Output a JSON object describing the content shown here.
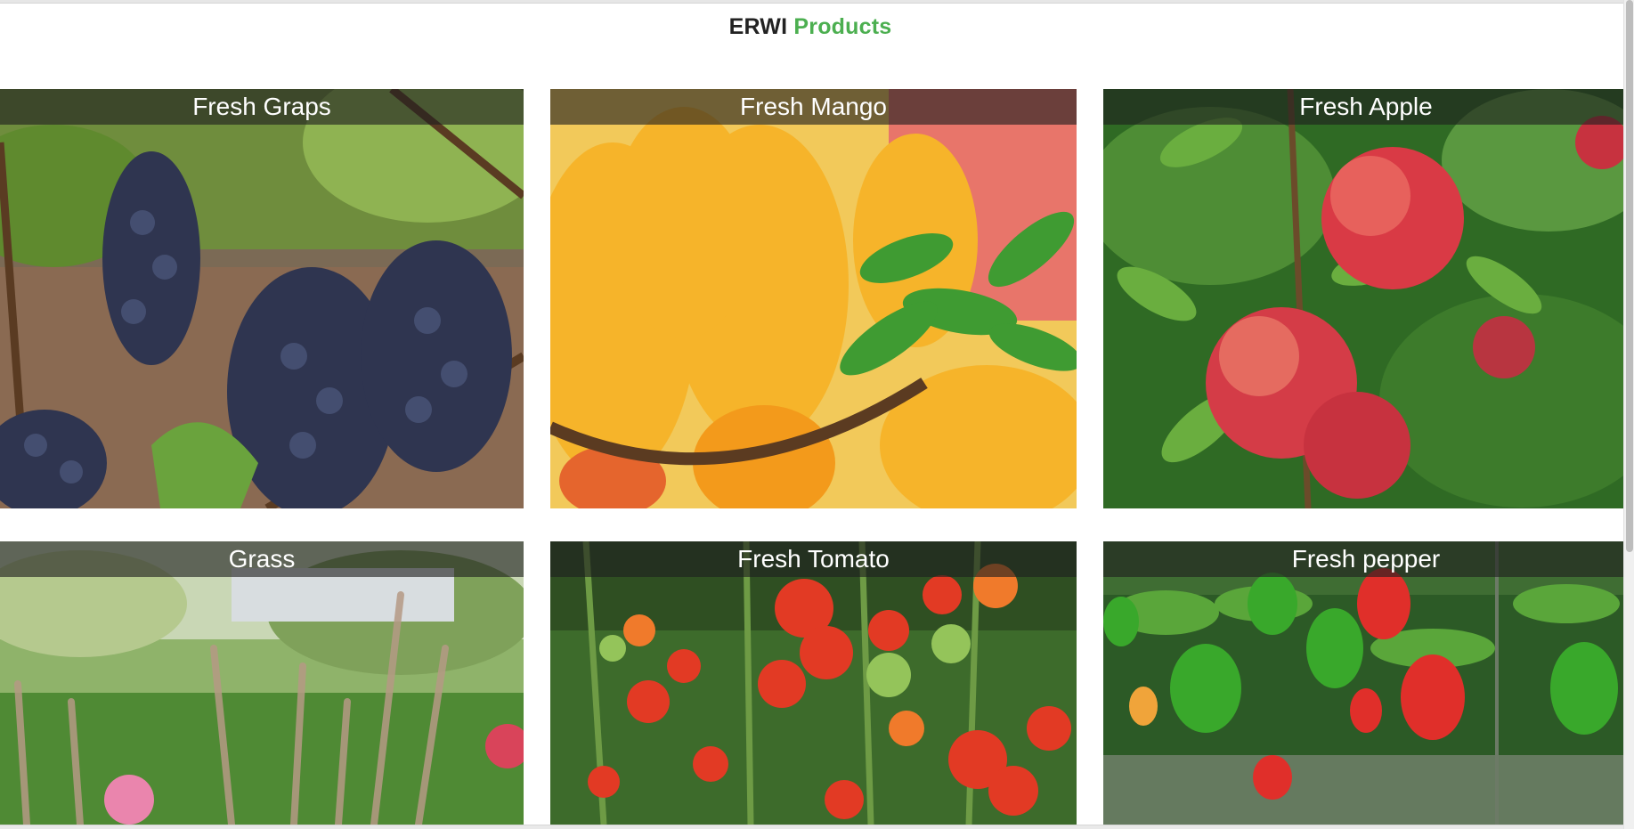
{
  "header": {
    "brand": "ERWI",
    "title_accent": "Products",
    "accent_color": "#4caf50"
  },
  "products": [
    {
      "label": "Fresh Graps"
    },
    {
      "label": "Fresh Mango"
    },
    {
      "label": "Fresh Apple"
    },
    {
      "label": "Grass"
    },
    {
      "label": "Fresh Tomato"
    },
    {
      "label": "Fresh pepper"
    }
  ]
}
